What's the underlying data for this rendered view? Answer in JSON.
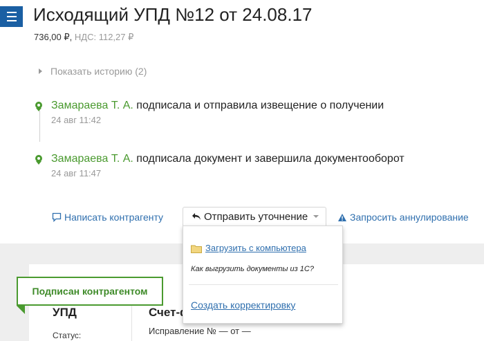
{
  "header": {
    "title": "Исходящий УПД №12 от 24.08.17",
    "amount": "736,00 ₽,",
    "vat": "НДС: 112,27 ₽"
  },
  "history": {
    "toggle_label": "Показать историю (2)"
  },
  "events": [
    {
      "author": "Замараева Т. А.",
      "action": "подписала и отправила извещение о получении",
      "time": "24 авг 11:42"
    },
    {
      "author": "Замараева Т. А.",
      "action": "подписала документ и завершила документооборот",
      "time": "24 авг 11:47"
    }
  ],
  "actions": {
    "write_label": "Написать контрагенту",
    "send_label": "Отправить уточнение",
    "cancel_label": "Запросить аннулирование"
  },
  "dropdown": {
    "upload_label": "Загрузить с компьютера",
    "how_label": "Как выгрузить документы из 1С?",
    "correct_label": "Создать корректировку"
  },
  "document": {
    "badge": "Подписан контрагентом",
    "type": "УПД",
    "status_label": "Статус:",
    "name": "Счет-ф",
    "fix_line": "Исправление № — от —"
  },
  "colors": {
    "accent_blue": "#2f6fae",
    "green": "#4a9a2f",
    "menu_blue": "#1a5fa3"
  },
  "icons": [
    "menu-icon",
    "chevron-right-icon",
    "location-pin-icon",
    "comment-icon",
    "reply-arrow-icon",
    "caret-down-icon",
    "warning-icon",
    "folder-icon"
  ]
}
